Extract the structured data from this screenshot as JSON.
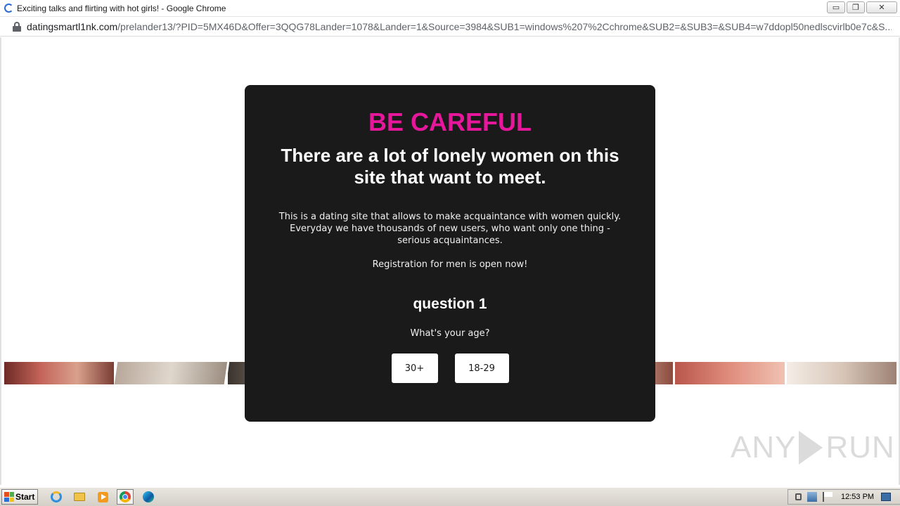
{
  "window": {
    "title": "Exciting talks and flirting with hot girls! - Google Chrome",
    "minimize_label": "▭",
    "restore_label": "❐",
    "close_label": "✕"
  },
  "address": {
    "host": "datingsmartl1nk.com",
    "path": "/prelander13/?PID=5MX46D&Offer=3QQG78Lander=1078&Lander=1&Source=3984&SUB1=windows%207%2Cchrome&SUB2=&SUB3=&SUB4=w7ddopl50nedlscvirlb0e7c&S..."
  },
  "modal": {
    "warning": "BE CAREFUL",
    "headline": "There are a lot of lonely women on this site that want to meet.",
    "description": "This is a dating site that allows to make acquaintance with women quickly. Everyday we have thousands of new users, who want only one thing - serious acquaintances.",
    "registration": "Registration for men is open now!",
    "question_title": "question 1",
    "question_text": "What's your age?",
    "answers": [
      "30+",
      "18-29"
    ]
  },
  "watermark": {
    "left": "ANY",
    "right": "RUN"
  },
  "taskbar": {
    "start_label": "Start",
    "clock": "12:53 PM"
  },
  "icons": [
    "loading-spinner-icon",
    "lock-icon",
    "windows-flag-icon",
    "internet-explorer-icon",
    "folder-icon",
    "media-player-icon",
    "chrome-icon",
    "edge-icon",
    "volume-icon",
    "network-icon",
    "action-center-flag-icon",
    "show-desktop-icon"
  ],
  "colors": {
    "warning": "#e6179a",
    "modal_bg": "#1a1a1a"
  }
}
